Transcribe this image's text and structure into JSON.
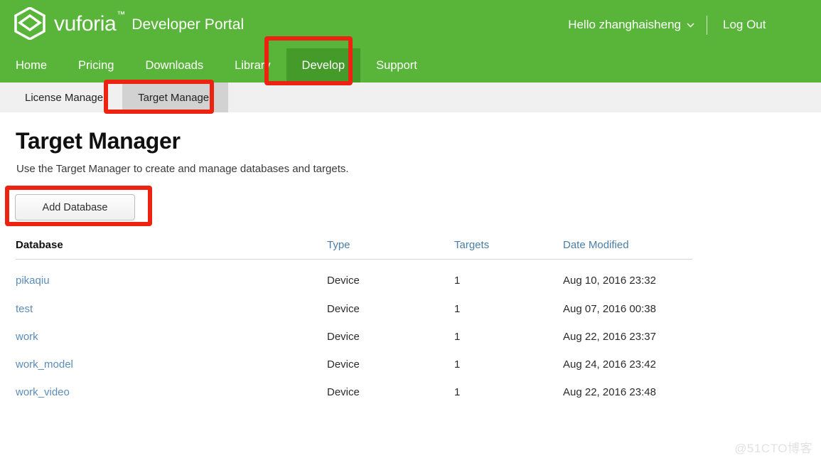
{
  "header": {
    "brand_word": "vuforia",
    "brand_tm": "™",
    "brand_sub": "Developer Portal",
    "account_greeting": "Hello zhanghaisheng",
    "logout_label": "Log Out",
    "brand_green": "#58b539",
    "active_nav_green": "#459b29"
  },
  "main_nav": [
    {
      "label": "Home",
      "active": false
    },
    {
      "label": "Pricing",
      "active": false
    },
    {
      "label": "Downloads",
      "active": false
    },
    {
      "label": "Library",
      "active": false
    },
    {
      "label": "Develop",
      "active": true
    },
    {
      "label": "Support",
      "active": false
    }
  ],
  "sub_nav": [
    {
      "label": "License Manager",
      "active": false
    },
    {
      "label": "Target Manager",
      "active": true
    }
  ],
  "main": {
    "title": "Target Manager",
    "description": "Use the Target Manager to create and manage databases and targets.",
    "add_database_label": "Add Database"
  },
  "table": {
    "headers": {
      "database": "Database",
      "type": "Type",
      "targets": "Targets",
      "date_modified": "Date Modified"
    },
    "sorted_column": "database",
    "header_link_color": "#4a7ea8",
    "row_link_color": "#5b8db8",
    "rows": [
      {
        "database": "pikaqiu",
        "type": "Device",
        "targets": "1",
        "date_modified": "Aug 10, 2016 23:32"
      },
      {
        "database": "test",
        "type": "Device",
        "targets": "1",
        "date_modified": "Aug 07, 2016 00:38"
      },
      {
        "database": "work",
        "type": "Device",
        "targets": "1",
        "date_modified": "Aug 22, 2016 23:37"
      },
      {
        "database": "work_model",
        "type": "Device",
        "targets": "1",
        "date_modified": "Aug 24, 2016 23:42"
      },
      {
        "database": "work_video",
        "type": "Device",
        "targets": "1",
        "date_modified": "Aug 22, 2016 23:48"
      }
    ]
  },
  "annotations": {
    "color": "#ee2211",
    "boxes": [
      {
        "target": "develop-nav-item"
      },
      {
        "target": "target-manager-subtab"
      },
      {
        "target": "add-database-button"
      }
    ]
  },
  "watermark": {
    "text": "@51CTO博客"
  }
}
